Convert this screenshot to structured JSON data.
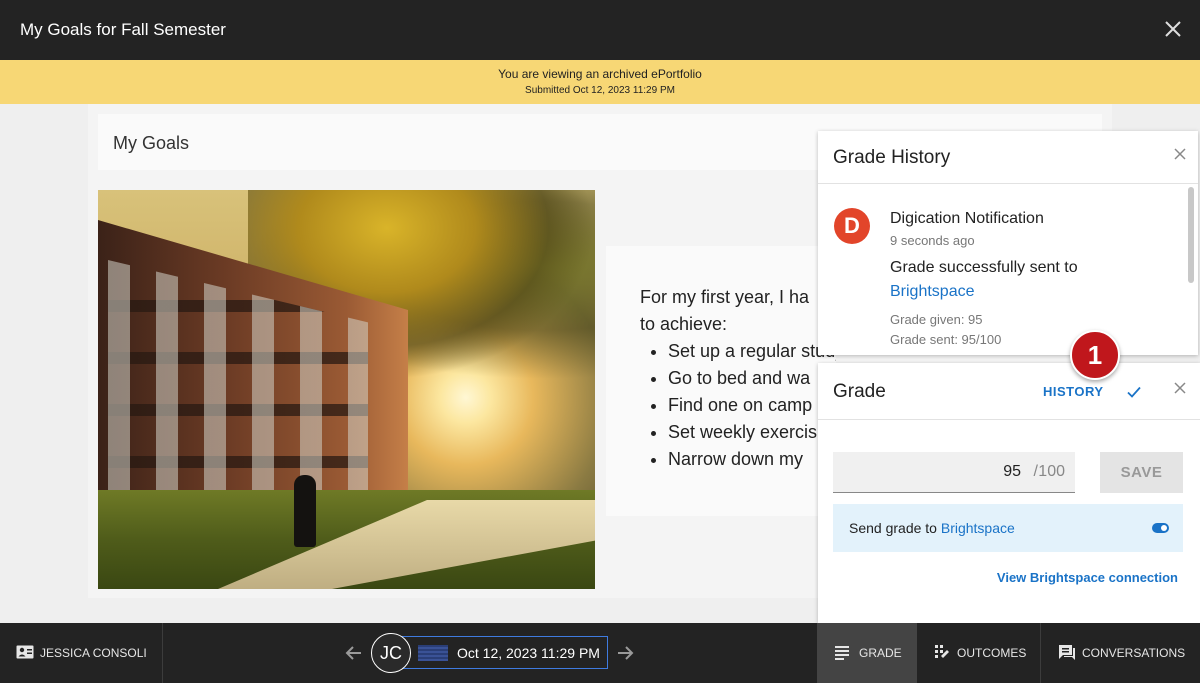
{
  "window": {
    "title": "My Goals for Fall Semester"
  },
  "banner": {
    "message": "You are viewing an archived ePortfolio",
    "submitted": "Submitted Oct 12, 2023 11:29 PM"
  },
  "content": {
    "heading": "My Goals",
    "intro_line1": "For my first year, I ha",
    "intro_line2": "to achieve:",
    "bullets": [
      "Set up a regular study routine",
      "Go to bed and wa",
      "Find one on camp",
      "Set weekly exercis",
      "Narrow down my"
    ]
  },
  "grade_history": {
    "title": "Grade History",
    "avatar_letter": "D",
    "sender": "Digication Notification",
    "time_ago": "9 seconds ago",
    "message": "Grade successfully sent to",
    "link": "Brightspace",
    "grade_given": "Grade given: 95",
    "grade_sent": "Grade sent: 95/100"
  },
  "grade_panel": {
    "title": "Grade",
    "history_label": "HISTORY",
    "score": "95",
    "separator": "/",
    "max": "100",
    "save_label": "SAVE",
    "send_prefix": "Send grade to",
    "send_link": "Brightspace",
    "send_enabled": true,
    "connection_link": "View Brightspace connection"
  },
  "callout": {
    "number": "1"
  },
  "bottom_bar": {
    "user_name": "JESSICA CONSOLI",
    "initials": "JC",
    "date": "Oct 12, 2023 11:29 PM",
    "tabs": {
      "grade": "GRADE",
      "outcomes": "OUTCOMES",
      "conversations": "CONVERSATIONS"
    }
  },
  "colors": {
    "topbar": "#232323",
    "banner": "#f7d775",
    "accent": "#1a73c7",
    "callout": "#c0171c",
    "avatar": "#e2452a"
  },
  "icons": {
    "close": "close-icon",
    "check": "check-icon",
    "prev": "arrow-left-icon",
    "next": "arrow-right-icon",
    "user": "contact-card-icon",
    "grade": "list-lines-icon",
    "outcomes": "outcomes-grid-icon",
    "conversations": "chat-bubble-icon"
  }
}
